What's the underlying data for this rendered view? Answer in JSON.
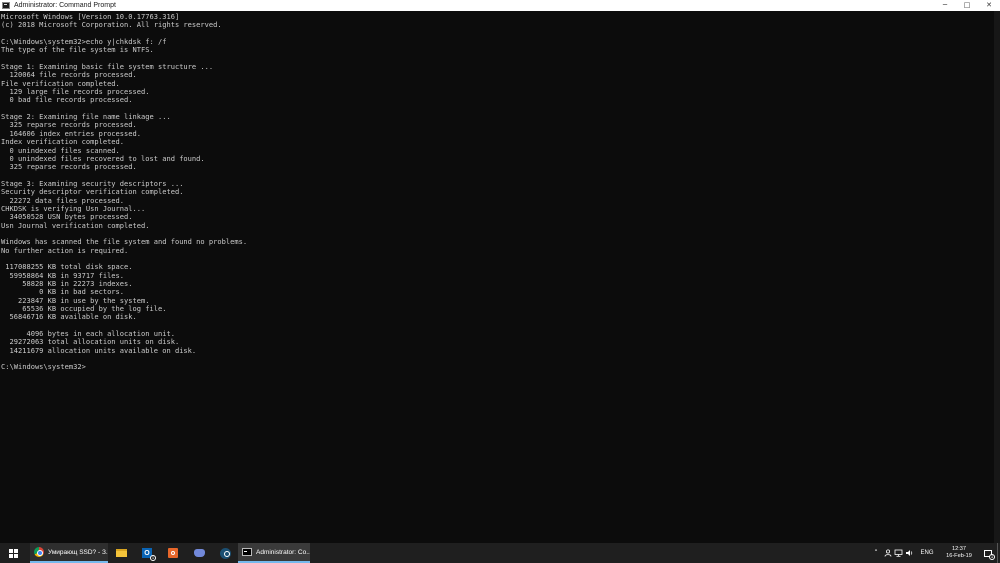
{
  "window": {
    "title": "Administrator: Command Prompt",
    "icon": "cmd-icon",
    "controls": {
      "minimize": "─",
      "maximize": "□",
      "close": "✕"
    }
  },
  "console": {
    "output": [
      "Microsoft Windows [Version 10.0.17763.316]",
      "(c) 2018 Microsoft Corporation. All rights reserved.",
      "",
      "C:\\Windows\\system32>echo y|chkdsk f: /f",
      "The type of the file system is NTFS.",
      "",
      "Stage 1: Examining basic file system structure ...",
      "  120064 file records processed.",
      "File verification completed.",
      "  129 large file records processed.",
      "  0 bad file records processed.",
      "",
      "Stage 2: Examining file name linkage ...",
      "  325 reparse records processed.",
      "  164606 index entries processed.",
      "Index verification completed.",
      "  0 unindexed files scanned.",
      "  0 unindexed files recovered to lost and found.",
      "  325 reparse records processed.",
      "",
      "Stage 3: Examining security descriptors ...",
      "Security descriptor verification completed.",
      "  22272 data files processed.",
      "CHKDSK is verifying Usn Journal...",
      "  34050528 USN bytes processed.",
      "Usn Journal verification completed.",
      "",
      "Windows has scanned the file system and found no problems.",
      "No further action is required.",
      "",
      " 117088255 KB total disk space.",
      "  59958864 KB in 93717 files.",
      "     58828 KB in 22273 indexes.",
      "         0 KB in bad sectors.",
      "    223847 KB in use by the system.",
      "     65536 KB occupied by the log file.",
      "  56846716 KB available on disk.",
      "",
      "      4096 bytes in each allocation unit.",
      "  29272063 total allocation units on disk.",
      "  14211679 allocation units available on disk.",
      "",
      "C:\\Windows\\system32>"
    ],
    "text_color": "#cccccc",
    "background_color": "#0c0c0c"
  },
  "taskbar": {
    "start_icon": "windows-logo-icon",
    "tasks": [
      {
        "label": "Умирающ SSD? - З...",
        "icon": "chrome-icon"
      },
      {
        "label": "Administrator: Co...",
        "icon": "cmd-icon"
      }
    ],
    "pinned": [
      {
        "icon": "file-explorer-icon"
      },
      {
        "icon": "outlook-icon",
        "glyph": "O",
        "badge": "1"
      },
      {
        "icon": "orange-app-icon"
      },
      {
        "icon": "discord-icon"
      },
      {
        "icon": "steam-icon"
      }
    ],
    "tray": {
      "chevron": "˄",
      "language": "ENG",
      "time": "12:37",
      "date": "16-Feb-19",
      "notification_count": "1",
      "accent_color": "#76b9ed"
    }
  }
}
